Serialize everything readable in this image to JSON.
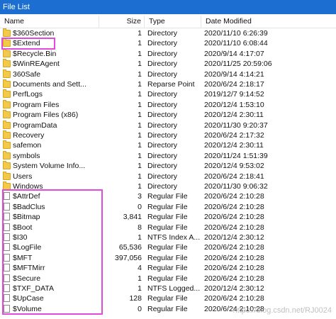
{
  "window": {
    "title": "File List"
  },
  "columns": {
    "name": "Name",
    "size": "Size",
    "type": "Type",
    "date": "Date Modified"
  },
  "accent_color": "#e14bdc",
  "rows": [
    {
      "icon": "folder",
      "name": "$360Section",
      "size": "1",
      "type": "Directory",
      "date": "2020/11/10 6:26:39"
    },
    {
      "icon": "folder",
      "name": "$Extend",
      "size": "1",
      "type": "Directory",
      "date": "2020/11/10 6:08:44"
    },
    {
      "icon": "folder",
      "name": "$Recycle.Bin",
      "size": "1",
      "type": "Directory",
      "date": "2020/9/14 4:17:07"
    },
    {
      "icon": "folder",
      "name": "$WinREAgent",
      "size": "1",
      "type": "Directory",
      "date": "2020/11/25 20:59:06"
    },
    {
      "icon": "folder",
      "name": "360Safe",
      "size": "1",
      "type": "Directory",
      "date": "2020/9/14 4:14:21"
    },
    {
      "icon": "folder",
      "name": "Documents and Sett...",
      "size": "1",
      "type": "Reparse Point",
      "date": "2020/6/24 2:18:17"
    },
    {
      "icon": "folder",
      "name": "PerfLogs",
      "size": "1",
      "type": "Directory",
      "date": "2019/12/7 9:14:52"
    },
    {
      "icon": "folder",
      "name": "Program Files",
      "size": "1",
      "type": "Directory",
      "date": "2020/12/4 1:53:10"
    },
    {
      "icon": "folder",
      "name": "Program Files (x86)",
      "size": "1",
      "type": "Directory",
      "date": "2020/12/4 2:30:11"
    },
    {
      "icon": "folder",
      "name": "ProgramData",
      "size": "1",
      "type": "Directory",
      "date": "2020/11/30 9:20:37"
    },
    {
      "icon": "folder",
      "name": "Recovery",
      "size": "1",
      "type": "Directory",
      "date": "2020/6/24 2:17:32"
    },
    {
      "icon": "folder",
      "name": "safemon",
      "size": "1",
      "type": "Directory",
      "date": "2020/12/4 2:30:11"
    },
    {
      "icon": "folder",
      "name": "symbols",
      "size": "1",
      "type": "Directory",
      "date": "2020/11/24 1:51:39"
    },
    {
      "icon": "folder",
      "name": "System Volume Info...",
      "size": "1",
      "type": "Directory",
      "date": "2020/12/4 9:53:02"
    },
    {
      "icon": "folder",
      "name": "Users",
      "size": "1",
      "type": "Directory",
      "date": "2020/6/24 2:18:41"
    },
    {
      "icon": "folder",
      "name": "Windows",
      "size": "1",
      "type": "Directory",
      "date": "2020/11/30 9:06:32"
    },
    {
      "icon": "file",
      "name": "$AttrDef",
      "size": "3",
      "type": "Regular File",
      "date": "2020/6/24 2:10:28"
    },
    {
      "icon": "file",
      "name": "$BadClus",
      "size": "0",
      "type": "Regular File",
      "date": "2020/6/24 2:10:28"
    },
    {
      "icon": "file",
      "name": "$Bitmap",
      "size": "3,841",
      "type": "Regular File",
      "date": "2020/6/24 2:10:28"
    },
    {
      "icon": "file",
      "name": "$Boot",
      "size": "8",
      "type": "Regular File",
      "date": "2020/6/24 2:10:28"
    },
    {
      "icon": "file",
      "name": "$I30",
      "size": "1",
      "type": "NTFS Index A...",
      "date": "2020/12/4 2:30:12"
    },
    {
      "icon": "file",
      "name": "$LogFile",
      "size": "65,536",
      "type": "Regular File",
      "date": "2020/6/24 2:10:28"
    },
    {
      "icon": "file",
      "name": "$MFT",
      "size": "397,056",
      "type": "Regular File",
      "date": "2020/6/24 2:10:28"
    },
    {
      "icon": "file",
      "name": "$MFTMirr",
      "size": "4",
      "type": "Regular File",
      "date": "2020/6/24 2:10:28"
    },
    {
      "icon": "file",
      "name": "$Secure",
      "size": "1",
      "type": "Regular File",
      "date": "2020/6/24 2:10:28"
    },
    {
      "icon": "file",
      "name": "$TXF_DATA",
      "size": "1",
      "type": "NTFS Logged...",
      "date": "2020/12/4 2:30:12"
    },
    {
      "icon": "file",
      "name": "$UpCase",
      "size": "128",
      "type": "Regular File",
      "date": "2020/6/24 2:10:28"
    },
    {
      "icon": "file",
      "name": "$Volume",
      "size": "0",
      "type": "Regular File",
      "date": "2020/6/24 2:10:28"
    }
  ],
  "watermark": "https://blog.csdn.net/RJ0024"
}
